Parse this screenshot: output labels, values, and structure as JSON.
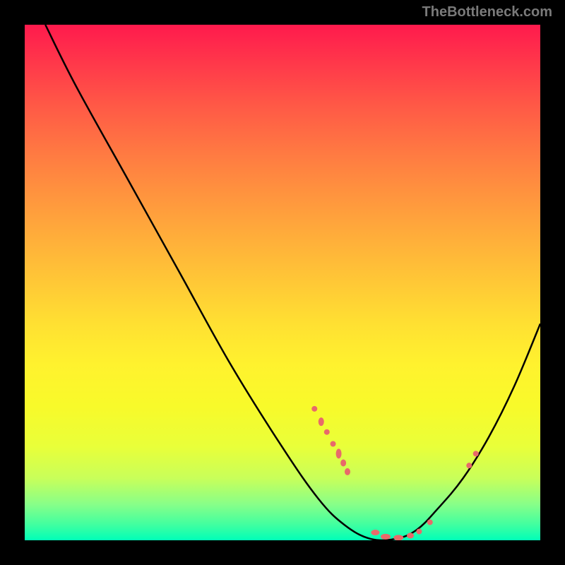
{
  "watermark": "TheBottleneck.com",
  "chart_data": {
    "type": "line",
    "title": "",
    "xlabel": "",
    "ylabel": "",
    "x_range": [
      0,
      100
    ],
    "y_range": [
      0,
      100
    ],
    "curve": [
      {
        "x": 4,
        "y": 100
      },
      {
        "x": 10,
        "y": 88
      },
      {
        "x": 20,
        "y": 70
      },
      {
        "x": 30,
        "y": 52
      },
      {
        "x": 40,
        "y": 34
      },
      {
        "x": 50,
        "y": 18
      },
      {
        "x": 57,
        "y": 8
      },
      {
        "x": 62,
        "y": 3
      },
      {
        "x": 67,
        "y": 0.3
      },
      {
        "x": 72,
        "y": 0.3
      },
      {
        "x": 76,
        "y": 2
      },
      {
        "x": 80,
        "y": 6
      },
      {
        "x": 85,
        "y": 12
      },
      {
        "x": 90,
        "y": 20
      },
      {
        "x": 95,
        "y": 30
      },
      {
        "x": 100,
        "y": 42
      }
    ],
    "marker_clusters": [
      {
        "x": 57.5,
        "y": 23,
        "rx": 4,
        "ry": 6
      },
      {
        "x": 58.6,
        "y": 21,
        "rx": 4,
        "ry": 4
      },
      {
        "x": 56.2,
        "y": 25.5,
        "rx": 4,
        "ry": 4
      },
      {
        "x": 59.8,
        "y": 18.7,
        "rx": 4,
        "ry": 4
      },
      {
        "x": 60.9,
        "y": 16.8,
        "rx": 4,
        "ry": 7
      },
      {
        "x": 61.8,
        "y": 15,
        "rx": 4,
        "ry": 5
      },
      {
        "x": 62.6,
        "y": 13.3,
        "rx": 4,
        "ry": 5
      },
      {
        "x": 68,
        "y": 1.5,
        "rx": 6,
        "ry": 4
      },
      {
        "x": 70,
        "y": 0.7,
        "rx": 7,
        "ry": 4
      },
      {
        "x": 72.5,
        "y": 0.5,
        "rx": 7,
        "ry": 4
      },
      {
        "x": 74.8,
        "y": 0.9,
        "rx": 5,
        "ry": 4
      },
      {
        "x": 76.5,
        "y": 1.7,
        "rx": 4,
        "ry": 4
      },
      {
        "x": 78.6,
        "y": 3.5,
        "rx": 4,
        "ry": 4
      },
      {
        "x": 86.2,
        "y": 14.5,
        "rx": 4,
        "ry": 4
      },
      {
        "x": 87.5,
        "y": 16.8,
        "rx": 4,
        "ry": 4
      }
    ],
    "gradient_colors": {
      "top": "#ff1a4d",
      "middle": "#ffe032",
      "bottom": "#00ffb8"
    },
    "marker_color": "#e86a6a",
    "curve_color": "#000000"
  }
}
